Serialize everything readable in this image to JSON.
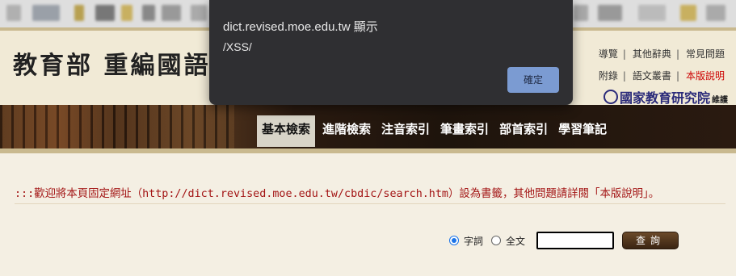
{
  "header": {
    "site_title": "教育部 重編國語辭",
    "links_row1": [
      "導覽",
      "其他辭典",
      "常見問題"
    ],
    "links_row2": [
      "附錄",
      "語文叢書",
      "本版說明"
    ],
    "institute": "國家教育研究院",
    "institute_suffix": "維護"
  },
  "nav": {
    "tabs": [
      "基本檢索",
      "進階檢索",
      "注音索引",
      "筆畫索引",
      "部首索引",
      "學習筆記"
    ],
    "active_tab": "基本檢索"
  },
  "main": {
    "welcome": ":::歡迎將本頁固定網址（http://dict.revised.moe.edu.tw/cbdic/search.htm）設為書籤，其他問題請詳閱「本版說明」。"
  },
  "search": {
    "option_word": "字詞",
    "option_fulltext": "全文",
    "selected": "字詞",
    "input_value": "",
    "button_label": "查詢"
  },
  "dialog": {
    "title": "dict.revised.moe.edu.tw 顯示",
    "message": "/XSS/",
    "ok_label": "確定"
  },
  "colors": {
    "nav_bg": "#2a1a10",
    "welcome_text": "#a31515",
    "dialog_bg": "#2f2f32",
    "ok_button": "#7b9bd2",
    "radio_accent": "#1a73e8"
  }
}
